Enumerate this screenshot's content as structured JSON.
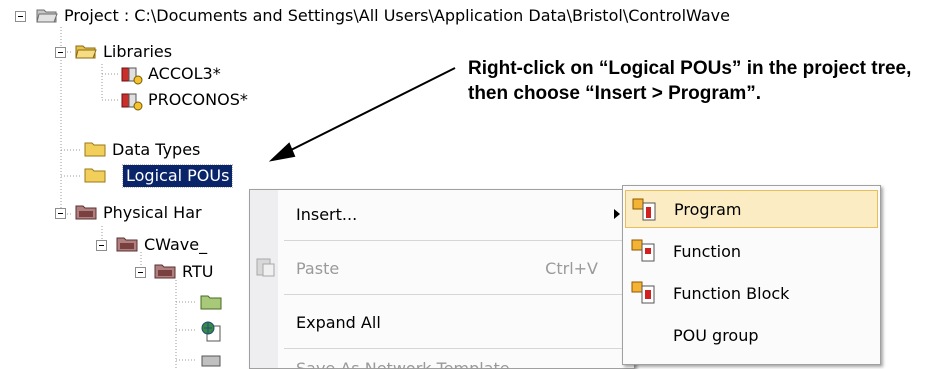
{
  "tree": {
    "project": "Project : C:\\Documents and Settings\\All Users\\Application Data\\Bristol\\ControlWave",
    "libraries": "Libraries",
    "accol3": "ACCOL3*",
    "proconos": "PROCONOS*",
    "data_types": "Data Types",
    "logical_pous": "Logical POUs",
    "physical_hardware": "Physical Har",
    "cwave": "CWave_",
    "rtu": "RTU"
  },
  "context_menu": {
    "insert": "Insert...",
    "paste": "Paste",
    "paste_shortcut": "Ctrl+V",
    "expand_all": "Expand All",
    "cut_off_item": "Save As Network Template"
  },
  "submenu": {
    "program": "Program",
    "function": "Function",
    "function_block": "Function Block",
    "pou_group": "POU group"
  },
  "annotation": {
    "text": "Right-click on “Logical POUs” in the project tree, then choose “Insert > Program”."
  },
  "colors": {
    "selection": "#0a246a",
    "menu_highlight": "#fbecc4",
    "folder": "#f2cf5a"
  }
}
